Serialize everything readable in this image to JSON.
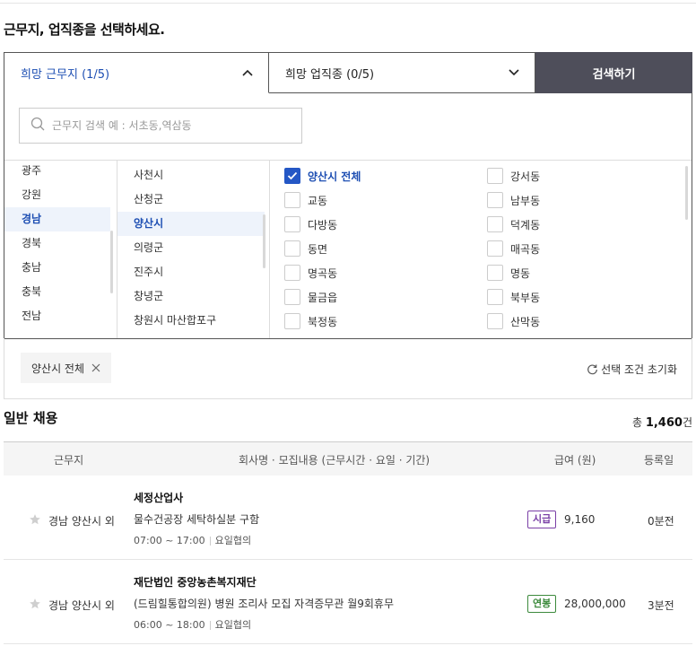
{
  "heading": "근무지, 업직종을 선택하세요.",
  "tabs": {
    "location": "희망 근무지 (1/5)",
    "job": "희망 업직종 (0/5)",
    "search_button": "검색하기"
  },
  "location_search": {
    "placeholder": "근무지 검색 예 : 서초동,역삼동"
  },
  "regions": [
    "광주",
    "강원",
    "경남",
    "경북",
    "충남",
    "충북",
    "전남"
  ],
  "selected_region": "경남",
  "districts": [
    "사천시",
    "산청군",
    "양산시",
    "의령군",
    "진주시",
    "창녕군",
    "창원시 마산합포구"
  ],
  "selected_district": "양산시",
  "dongs_left": [
    {
      "label": "양산시 전체",
      "checked": true
    },
    {
      "label": "교동",
      "checked": false
    },
    {
      "label": "다방동",
      "checked": false
    },
    {
      "label": "동면",
      "checked": false
    },
    {
      "label": "명곡동",
      "checked": false
    },
    {
      "label": "물금읍",
      "checked": false
    },
    {
      "label": "북정동",
      "checked": false
    }
  ],
  "dongs_right": [
    {
      "label": "강서동",
      "checked": false
    },
    {
      "label": "남부동",
      "checked": false
    },
    {
      "label": "덕계동",
      "checked": false
    },
    {
      "label": "매곡동",
      "checked": false
    },
    {
      "label": "명동",
      "checked": false
    },
    {
      "label": "북부동",
      "checked": false
    },
    {
      "label": "산막동",
      "checked": false
    }
  ],
  "chip": "양산시 전체",
  "reset_label": "선택 조건 초기화",
  "jobs": {
    "title": "일반 채용",
    "total_prefix": "총 ",
    "total_count": "1,460",
    "total_suffix": "건",
    "columns": [
      "근무지",
      "회사명 · 모집내용 (근무시간 · 요일 · 기간)",
      "급여 (원)",
      "등록일"
    ],
    "rows": [
      {
        "location": "경남 양산시 외",
        "company": "세정산업사",
        "title": "물수건공장 세탁하실분 구함",
        "time": "07:00 ~ 17:00",
        "days": "요일협의",
        "pay_type": "시급",
        "wage": "9,160",
        "date": "0분전"
      },
      {
        "location": "경남 양산시 외",
        "company": "재단법인 중앙농촌복지재단",
        "title": "(드림힐통합의원) 병원 조리사 모집 자격증무관 월9회휴무",
        "time": "06:00 ~ 18:00",
        "days": "요일협의",
        "pay_type": "연봉",
        "wage": "28,000,000",
        "date": "3분전"
      }
    ]
  },
  "colors": {
    "accent_blue": "#1e4fb3",
    "search_button_bg": "#4e4e5a",
    "badge_hourly": "#7a3fa6",
    "badge_annual": "#3c8a3c"
  }
}
